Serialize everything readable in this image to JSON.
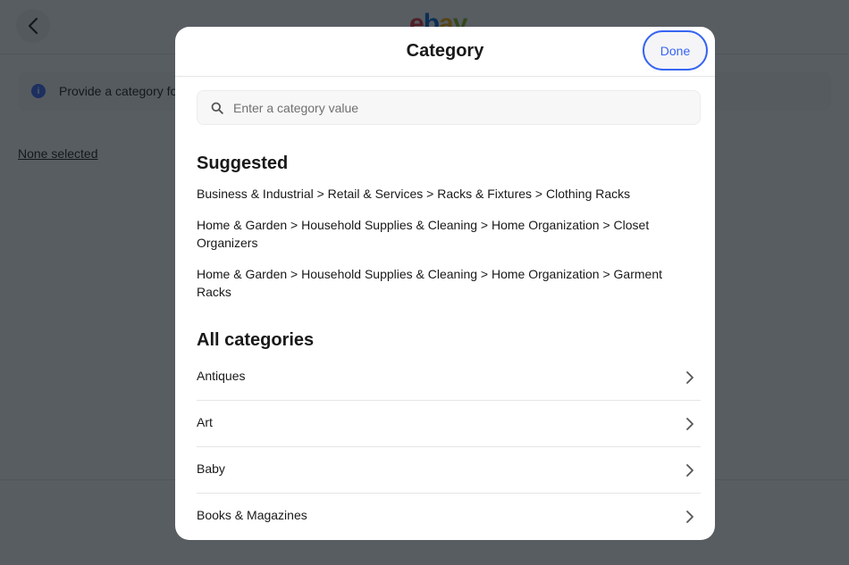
{
  "background": {
    "logo": [
      "e",
      "b",
      "a",
      "y"
    ],
    "info_banner_text": "Provide a category for your listing",
    "none_selected_link": "None selected"
  },
  "modal": {
    "title": "Category",
    "done_label": "Done",
    "search": {
      "placeholder": "Enter a category value",
      "value": ""
    },
    "suggested": {
      "heading": "Suggested",
      "items": [
        "Business & Industrial > Retail & Services > Racks & Fixtures > Clothing Racks",
        "Home & Garden > Household Supplies & Cleaning > Home Organization > Closet Organizers",
        "Home & Garden > Household Supplies & Cleaning > Home Organization > Garment Racks"
      ]
    },
    "all_categories": {
      "heading": "All categories",
      "items": [
        "Antiques",
        "Art",
        "Baby",
        "Books & Magazines"
      ]
    }
  },
  "icons": {
    "back": "chevron-left-icon",
    "info": "info-icon",
    "search": "search-icon",
    "row_chevron": "chevron-right-icon"
  },
  "colors": {
    "accent": "#3665f3",
    "text": "#191919",
    "overlay": "rgba(17,24,32,0.70)"
  }
}
